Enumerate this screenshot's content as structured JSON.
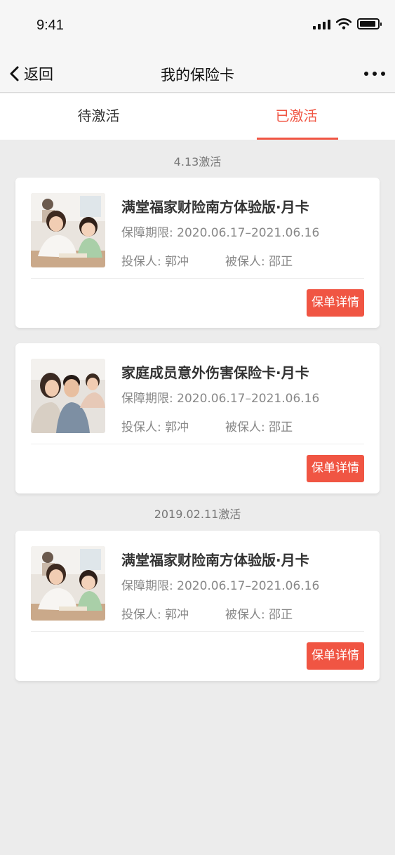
{
  "status_bar": {
    "time": "9:41",
    "icons": [
      "signal-icon",
      "wifi-icon",
      "battery-icon"
    ]
  },
  "nav": {
    "back_label": "返回",
    "title": "我的保险卡",
    "more_icon": "more-icon"
  },
  "tabs": [
    {
      "label": "待激活",
      "active": false
    },
    {
      "label": "已激活",
      "active": true
    }
  ],
  "colors": {
    "accent": "#f05543",
    "background": "#ececec",
    "card": "#ffffff"
  },
  "groups": [
    {
      "date": "4.13激活",
      "cards": [
        {
          "title": "满堂福家财险南方体验版·月卡",
          "period": "保障期限: 2020.06.17–2021.06.16",
          "holder": "投保人: 郭冲",
          "insured": "被保人: 邵正",
          "button": "保单详情",
          "image": "family-photo-mother-daughter"
        },
        {
          "title": "家庭成员意外伤害保险卡·月卡",
          "period": "保障期限: 2020.06.17–2021.06.16",
          "holder": "投保人: 郭冲",
          "insured": "被保人: 邵正",
          "button": "保单详情",
          "image": "family-photo-parents-child"
        }
      ]
    },
    {
      "date": "2019.02.11激活",
      "cards": [
        {
          "title": "满堂福家财险南方体验版·月卡",
          "period": "保障期限: 2020.06.17–2021.06.16",
          "holder": "投保人: 郭冲",
          "insured": "被保人: 邵正",
          "button": "保单详情",
          "image": "family-photo-mother-daughter"
        }
      ]
    }
  ]
}
